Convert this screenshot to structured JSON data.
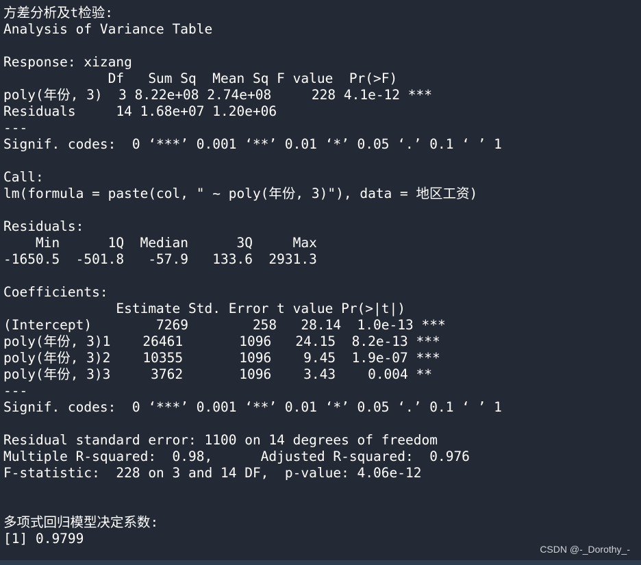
{
  "console": {
    "lines": [
      "方差分析及t检验:",
      "Analysis of Variance Table",
      "",
      "Response: xizang",
      "             Df   Sum Sq  Mean Sq F value  Pr(>F)",
      "poly(年份, 3)  3 8.22e+08 2.74e+08     228 4.1e-12 ***",
      "Residuals     14 1.68e+07 1.20e+06",
      "---",
      "Signif. codes:  0 ‘***’ 0.001 ‘**’ 0.01 ‘*’ 0.05 ‘.’ 0.1 ‘ ’ 1",
      "",
      "Call:",
      "lm(formula = paste(col, \" ~ poly(年份, 3)\"), data = 地区工资)",
      "",
      "Residuals:",
      "    Min      1Q  Median      3Q     Max",
      "-1650.5  -501.8   -57.9   133.6  2931.3",
      "",
      "Coefficients:",
      "              Estimate Std. Error t value Pr(>|t|)",
      "(Intercept)        7269        258   28.14  1.0e-13 ***",
      "poly(年份, 3)1    26461       1096   24.15  8.2e-13 ***",
      "poly(年份, 3)2    10355       1096    9.45  1.9e-07 ***",
      "poly(年份, 3)3     3762       1096    3.43    0.004 **",
      "---",
      "Signif. codes:  0 ‘***’ 0.001 ‘**’ 0.01 ‘*’ 0.05 ‘.’ 0.1 ‘ ’ 1",
      "",
      "Residual standard error: 1100 on 14 degrees of freedom",
      "Multiple R-squared:  0.98,      Adjusted R-squared:  0.976",
      "F-statistic:  228 on 3 and 14 DF,  p-value: 4.06e-12",
      "",
      "",
      "多项式回归模型决定系数:",
      "[1] 0.9799"
    ]
  },
  "watermark": "CSDN @-_Dorothy_-"
}
